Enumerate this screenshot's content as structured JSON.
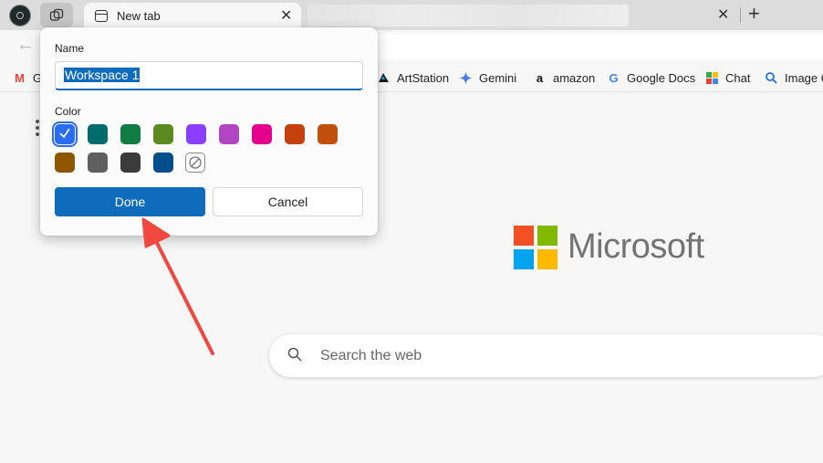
{
  "tabs": {
    "active_title": "New tab",
    "close_glyph": "✕",
    "new_tab_glyph": "+"
  },
  "toolbar": {
    "back_glyph": "←"
  },
  "bookmarks": [
    {
      "label": "ArtStation",
      "icon": "artstation-icon",
      "color": "#13aff0"
    },
    {
      "label": "Gemini",
      "icon": "gemini-icon",
      "color": "#4a7df0"
    },
    {
      "label": "amazon",
      "icon": "amazon-icon",
      "color": "#111111"
    },
    {
      "label": "Google Docs",
      "icon": "google-icon",
      "color": "#4285f4"
    },
    {
      "label": "Chat",
      "icon": "google-chat-icon",
      "color": "#34a853"
    },
    {
      "label": "Image G",
      "icon": "search-icon",
      "color": "#1a73e8"
    }
  ],
  "popup": {
    "name_label": "Name",
    "name_value": "Workspace 1",
    "color_label": "Color",
    "colors": [
      "#2b6df0",
      "#006b6b",
      "#107c41",
      "#5c8a1e",
      "#8a3ffc",
      "#b146c2",
      "#e3008c",
      "#c4400c",
      "#c2500c",
      "#8e5600",
      "#5f5f5f",
      "#3b3b3b",
      "#004e8c"
    ],
    "selected_color": "#2b6df0",
    "done_label": "Done",
    "cancel_label": "Cancel"
  },
  "brand": {
    "name": "Microsoft",
    "logo_colors": [
      "#f25022",
      "#7fba00",
      "#00a4ef",
      "#ffb900"
    ]
  },
  "search": {
    "placeholder": "Search the web"
  },
  "annotation": {
    "arrow_color": "#f0483e"
  }
}
